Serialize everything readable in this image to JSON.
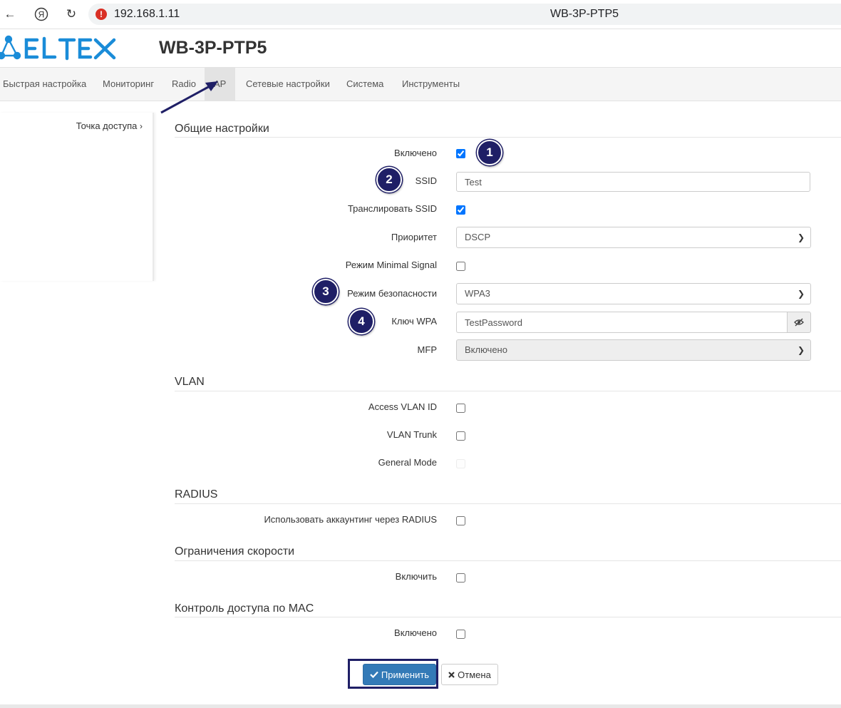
{
  "browser": {
    "url": "192.168.1.11",
    "page_title": "WB-3P-PTP5"
  },
  "header": {
    "logo_text": "ELTEX",
    "device_title": "WB-3P-PTP5",
    "logo_color": "#1a8cd8"
  },
  "menu": {
    "items": [
      "Быстрая настройка",
      "Мониторинг",
      "Radio",
      "AP",
      "Сетевые настройки",
      "Система",
      "Инструменты"
    ],
    "active": "AP"
  },
  "sidebar": {
    "link": "Точка доступа"
  },
  "general": {
    "title": "Общие настройки",
    "enabled_label": "Включено",
    "enabled": true,
    "ssid_label": "SSID",
    "ssid_value": "Test",
    "broadcast_label": "Транслировать SSID",
    "broadcast": true,
    "priority_label": "Приоритет",
    "priority_value": "DSCP",
    "minimal_signal_label": "Режим Minimal Signal",
    "minimal_signal": false,
    "security_label": "Режим безопасности",
    "security_value": "WPA3",
    "wpa_key_label": "Ключ WPA",
    "wpa_key_value": "TestPassword",
    "mfp_label": "MFP",
    "mfp_value": "Включено"
  },
  "vlan": {
    "title": "VLAN",
    "access_label": "Access VLAN ID",
    "trunk_label": "VLAN Trunk",
    "general_label": "General Mode"
  },
  "radius": {
    "title": "RADIUS",
    "accounting_label": "Использовать аккаунтинг через RADIUS"
  },
  "rate": {
    "title": "Ограничения скорости",
    "enable_label": "Включить"
  },
  "mac": {
    "title": "Контроль доступа по MAC",
    "enabled_label": "Включено"
  },
  "buttons": {
    "apply": "Применить",
    "cancel": "Отмена"
  },
  "annotations": {
    "badges": [
      "1",
      "2",
      "3",
      "4"
    ],
    "color": "#1f1f66"
  },
  "icons": {
    "apply": "check-icon",
    "cancel": "x-icon",
    "password_toggle": "eye-slash-icon"
  }
}
